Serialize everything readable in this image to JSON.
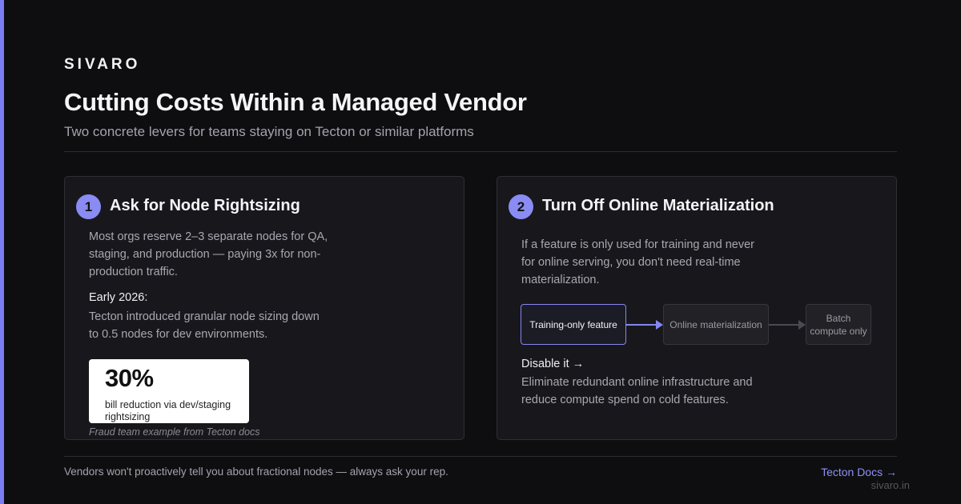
{
  "brand": "SIVARO",
  "title": "Cutting Costs Within a Managed Vendor",
  "subtitle": "Two concrete levers for teams staying on Tecton or similar platforms",
  "cards": [
    {
      "number": "1",
      "title": "Ask for Node Rightsizing",
      "paragraph": "Most orgs reserve 2–3 separate nodes for QA, staging, and production — paying 3x for non-production traffic.",
      "highlight_label": "Early 2026:",
      "highlight_text": "Tecton introduced granular node sizing down to 0.5 nodes for dev environments.",
      "stat": {
        "value": "30%",
        "description": "bill reduction via dev/staging rightsizing"
      },
      "note": "Fraud team example from Tecton docs"
    },
    {
      "number": "2",
      "title": "Turn Off Online Materialization",
      "paragraph": "If a feature is only used for training and never for online serving, you don't need real-time materialization.",
      "flow": [
        "Training-only feature",
        "Online materialization",
        "Batch compute only"
      ],
      "action_label": "Disable it →",
      "action_text": "Eliminate redundant online infrastructure and reduce compute spend on cold features."
    }
  ],
  "footer": {
    "text": "Vendors won't proactively tell you about fractional nodes — always ask your rep.",
    "link": "Tecton Docs →"
  },
  "watermark": "sivaro.in",
  "colors": {
    "background": "#0e0e11",
    "accent": "#7b7ef0",
    "card": "#18181c",
    "muted_text": "#a3a3ad"
  }
}
